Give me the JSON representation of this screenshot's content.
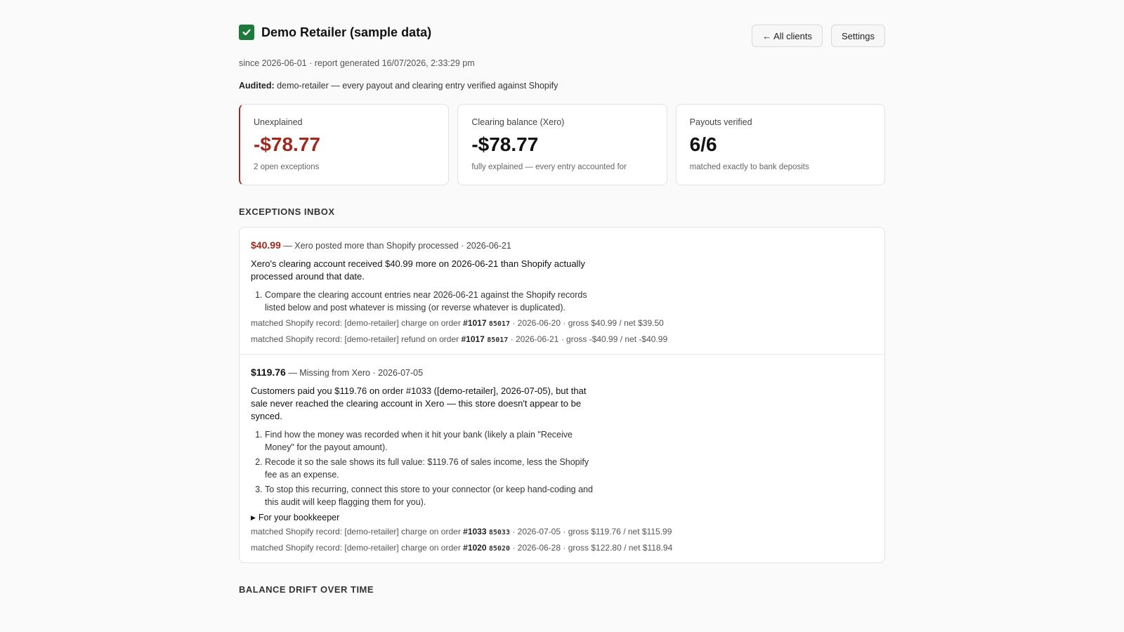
{
  "header": {
    "title": "Demo Retailer (sample data)",
    "check_icon": "check-icon",
    "buttons": {
      "all_clients": "← All clients",
      "settings": "Settings"
    }
  },
  "meta": "since 2026-06-01 · report generated 16/07/2026, 2:33:29 pm",
  "audited": {
    "label": "Audited:",
    "text": " demo-retailer — every payout and clearing entry verified against Shopify"
  },
  "cards": [
    {
      "label": "Unexplained",
      "value": "-$78.77",
      "sub": "2 open exceptions"
    },
    {
      "label": "Clearing balance (Xero)",
      "value": "-$78.77",
      "sub": "fully explained — every entry accounted for"
    },
    {
      "label": "Payouts verified",
      "value": "6/6",
      "sub": "matched exactly to bank deposits"
    }
  ],
  "inbox_title": "EXCEPTIONS INBOX",
  "exceptions": [
    {
      "amount": "$40.99",
      "head": " — Xero posted more than Shopify processed · 2026-06-21",
      "desc": "Xero's clearing account received $40.99 more on 2026-06-21 than Shopify actually processed around that date.",
      "steps": [
        "Compare the clearing account entries near 2026-06-21 against the Shopify records listed below and post whatever is missing (or reverse whatever is duplicated)."
      ],
      "records": [
        {
          "pre": "matched Shopify record: [demo-retailer] charge on order ",
          "order": "#1017",
          "code": "85017",
          "post": " · 2026-06-20 · gross $40.99 / net $39.50"
        },
        {
          "pre": "matched Shopify record: [demo-retailer] refund on order ",
          "order": "#1017",
          "code": "85017",
          "post": " · 2026-06-21 · gross -$40.99 / net -$40.99"
        }
      ]
    },
    {
      "amount": "$119.76",
      "head": " — Missing from Xero · 2026-07-05",
      "desc": "Customers paid you $119.76 on order #1033 ([demo-retailer], 2026-07-05), but that sale never reached the clearing account in Xero — this store doesn't appear to be synced.",
      "steps": [
        "Find how the money was recorded when it hit your bank (likely a plain \"Receive Money\" for the payout amount).",
        "Recode it so the sale shows its full value: $119.76 of sales income, less the Shopify fee as an expense.",
        "To stop this recurring, connect this store to your connector (or keep hand-coding and this audit will keep flagging them for you)."
      ],
      "bookkeeper": "For your bookkeeper",
      "records": [
        {
          "pre": "matched Shopify record: [demo-retailer] charge on order ",
          "order": "#1033",
          "code": "85033",
          "post": " · 2026-07-05 · gross $119.76 / net $115.99"
        },
        {
          "pre": "matched Shopify record: [demo-retailer] charge on order ",
          "order": "#1020",
          "code": "85020",
          "post": " · 2026-06-28 · gross $122.80 / net $118.94"
        }
      ]
    }
  ],
  "drift_title": "BALANCE DRIFT OVER TIME",
  "colors": {
    "accent_red": "#9e2a1f",
    "check_green": "#1e7a3c"
  }
}
